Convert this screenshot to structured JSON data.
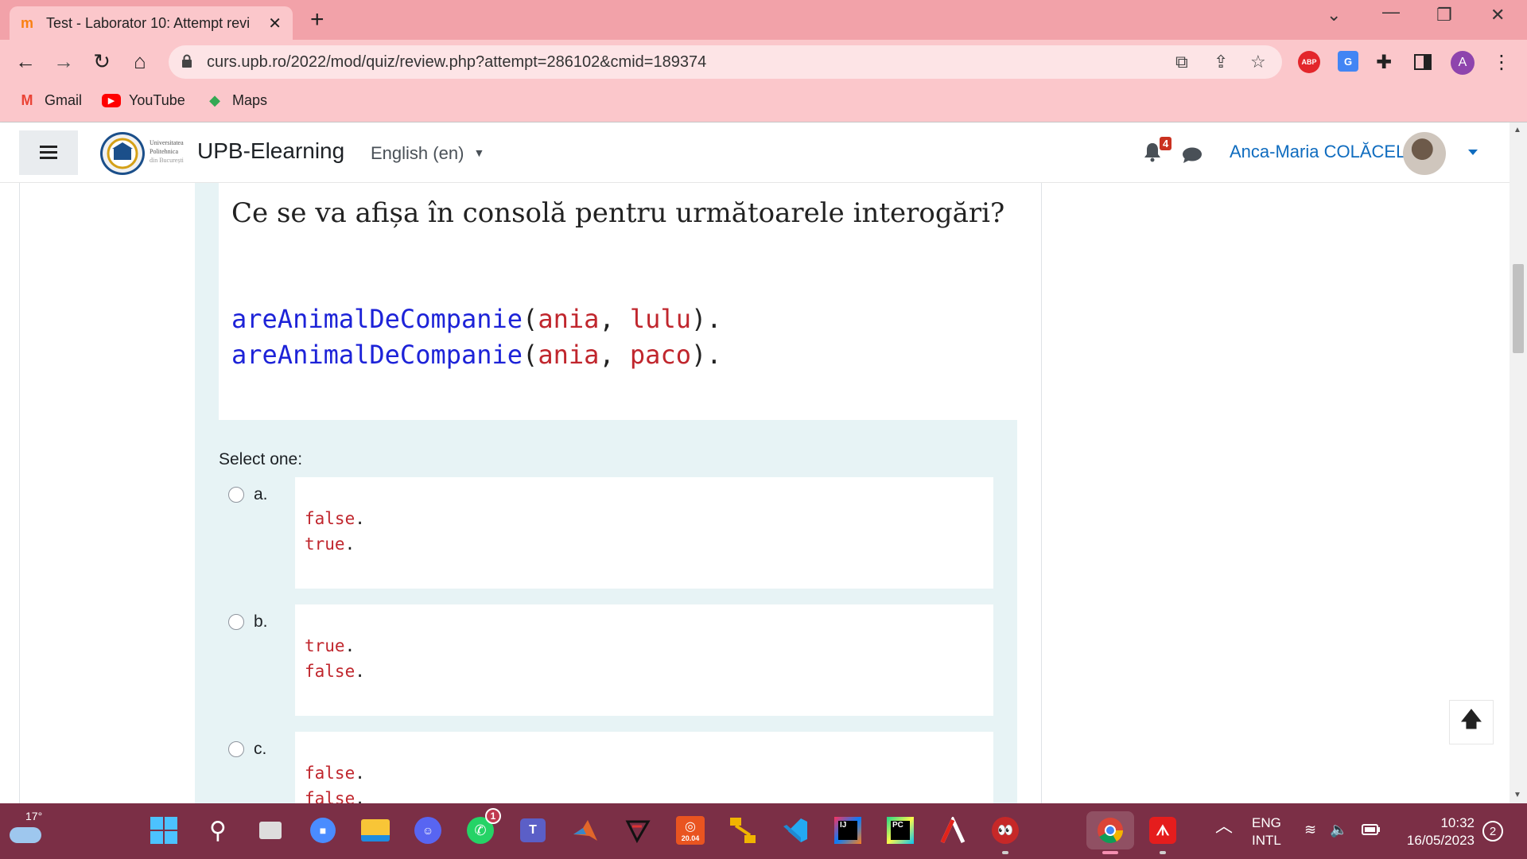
{
  "browser": {
    "tab_title": "Test - Laborator 10: Attempt revi",
    "tab_icon": "moodle-icon",
    "url": "curs.upb.ro/2022/mod/quiz/review.php?attempt=286102&cmid=189374",
    "bookmarks": [
      {
        "label": "Gmail",
        "icon": "gmail-icon",
        "color": "#ea4335"
      },
      {
        "label": "YouTube",
        "icon": "youtube-icon",
        "color": "#ff0000"
      },
      {
        "label": "Maps",
        "icon": "maps-icon",
        "color": "#34a853"
      }
    ],
    "extensions": {
      "abp": "ABP",
      "translate": "G",
      "profile": "A"
    }
  },
  "navbar": {
    "brand": "UPB-Elearning",
    "logo_text_1": "Universitatea",
    "logo_text_2": "Politehnica",
    "logo_text_3": "din București",
    "language": "English (en)",
    "notification_count": "4",
    "user_name": "Anca-Maria COLĂCEL"
  },
  "question": {
    "text": "Ce se va afișa în consolă pentru următoarele interogări?",
    "code_lines": [
      {
        "fn": "areAnimalDeCompanie",
        "arg1": "ania",
        "arg2": "lulu"
      },
      {
        "fn": "areAnimalDeCompanie",
        "arg1": "ania",
        "arg2": "paco"
      }
    ],
    "select_label": "Select one:",
    "options": [
      {
        "letter": "a.",
        "lines": [
          "false",
          "true"
        ]
      },
      {
        "letter": "b.",
        "lines": [
          "true",
          "false"
        ]
      },
      {
        "letter": "c.",
        "lines": [
          "false",
          "false"
        ]
      }
    ]
  },
  "taskbar": {
    "temperature": "17°",
    "apps": [
      "windows-start",
      "search",
      "task-view",
      "zoom",
      "file-explorer",
      "discord",
      "whatsapp",
      "teams",
      "matlab",
      "logisim",
      "ubuntu",
      "git-kraken",
      "vscode",
      "intellij",
      "pycharm",
      "archicad",
      "among-us",
      "chrome",
      "acrobat"
    ],
    "whatsapp_badge": "1",
    "ubuntu_label": "20.04",
    "lang_1": "ENG",
    "lang_2": "INTL",
    "time": "10:32",
    "date": "16/05/2023",
    "notification_count": "2"
  },
  "colors": {
    "chrome_bg": "#fbc7cb",
    "link": "#0f6cbf",
    "code_fn": "#1d23d8",
    "code_arg": "#c0262d",
    "taskbar": "#7b2f46"
  }
}
